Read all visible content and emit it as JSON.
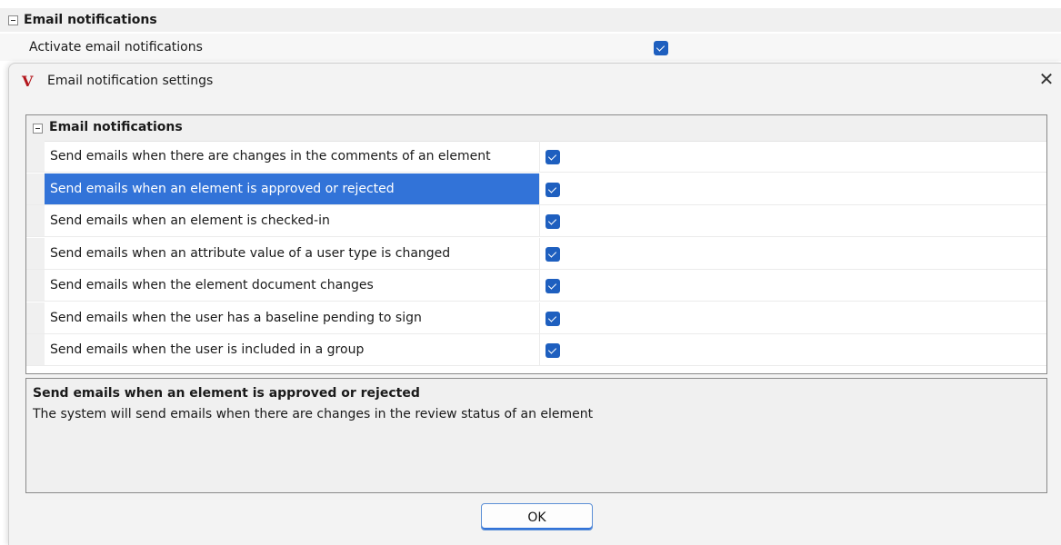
{
  "background_panel": {
    "section_title": "Email notifications",
    "row_label": "Activate email notifications",
    "row_checked": true
  },
  "dialog": {
    "title": "Email notification settings",
    "app_icon": "v-logo-icon",
    "close_glyph": "✕",
    "grid": {
      "section_title": "Email notifications",
      "rows": [
        {
          "label": "Send emails when there are changes in the comments of an element",
          "checked": true
        },
        {
          "label": "Send emails when an element is approved or rejected",
          "checked": true
        },
        {
          "label": "Send emails when an element is checked-in",
          "checked": true
        },
        {
          "label": "Send emails when an attribute value of a user type is changed",
          "checked": true
        },
        {
          "label": "Send emails when the element document changes",
          "checked": true
        },
        {
          "label": "Send emails when the user has a baseline pending to sign",
          "checked": true
        },
        {
          "label": "Send emails when the user is included in a group",
          "checked": true
        }
      ],
      "selected_index": 1
    },
    "description": {
      "title": "Send emails when an element is approved or rejected",
      "text": "The system will send emails when there are changes in the review status of an element"
    },
    "ok_label": "OK"
  },
  "colors": {
    "selection": "#3273d8",
    "checkbox": "#1e5fbf",
    "app_icon": "#b3151b"
  }
}
